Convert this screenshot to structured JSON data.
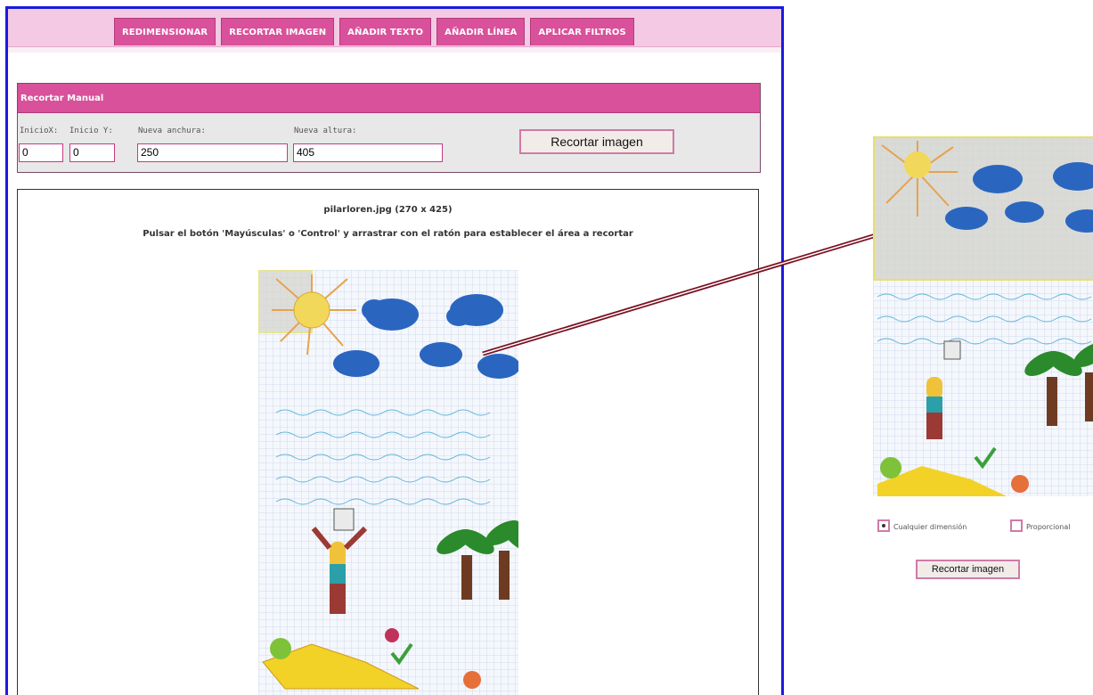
{
  "tabs": [
    {
      "label": "REDIMENSIONAR"
    },
    {
      "label": "RECORTAR IMAGEN"
    },
    {
      "label": "AÑADIR TEXTO"
    },
    {
      "label": "AÑADIR LÍNEA"
    },
    {
      "label": "APLICAR FILTROS"
    }
  ],
  "manual_crop": {
    "title": "Recortar Manual",
    "fields": {
      "start_x": {
        "label": "InicioX:",
        "value": "0"
      },
      "start_y": {
        "label": "Inicio Y:",
        "value": "0"
      },
      "new_width": {
        "label": "Nueva anchura:",
        "value": "250"
      },
      "new_height": {
        "label": "Nueva altura:",
        "value": "405"
      }
    },
    "crop_button": "Recortar imagen"
  },
  "image_area": {
    "filename": "pilarloren.jpg (270 x 425)",
    "instructions": "Pulsar el botón 'Mayúsculas' o 'Control' y arrastrar con el ratón para establecer el área a recortar"
  },
  "preview": {
    "options": [
      {
        "label": "Cualquier dimensión",
        "selected": true
      },
      {
        "label": "Proporcional",
        "selected": false
      }
    ],
    "crop_button": "Recortar imagen"
  },
  "colors": {
    "tab": "#d9519a",
    "tabbar": "#f3c9e3",
    "frame": "#1a1ae0",
    "arrow": "#7a1020"
  },
  "icons": [
    "radio-selected-icon",
    "radio-empty-icon",
    "arrow-pointer"
  ]
}
